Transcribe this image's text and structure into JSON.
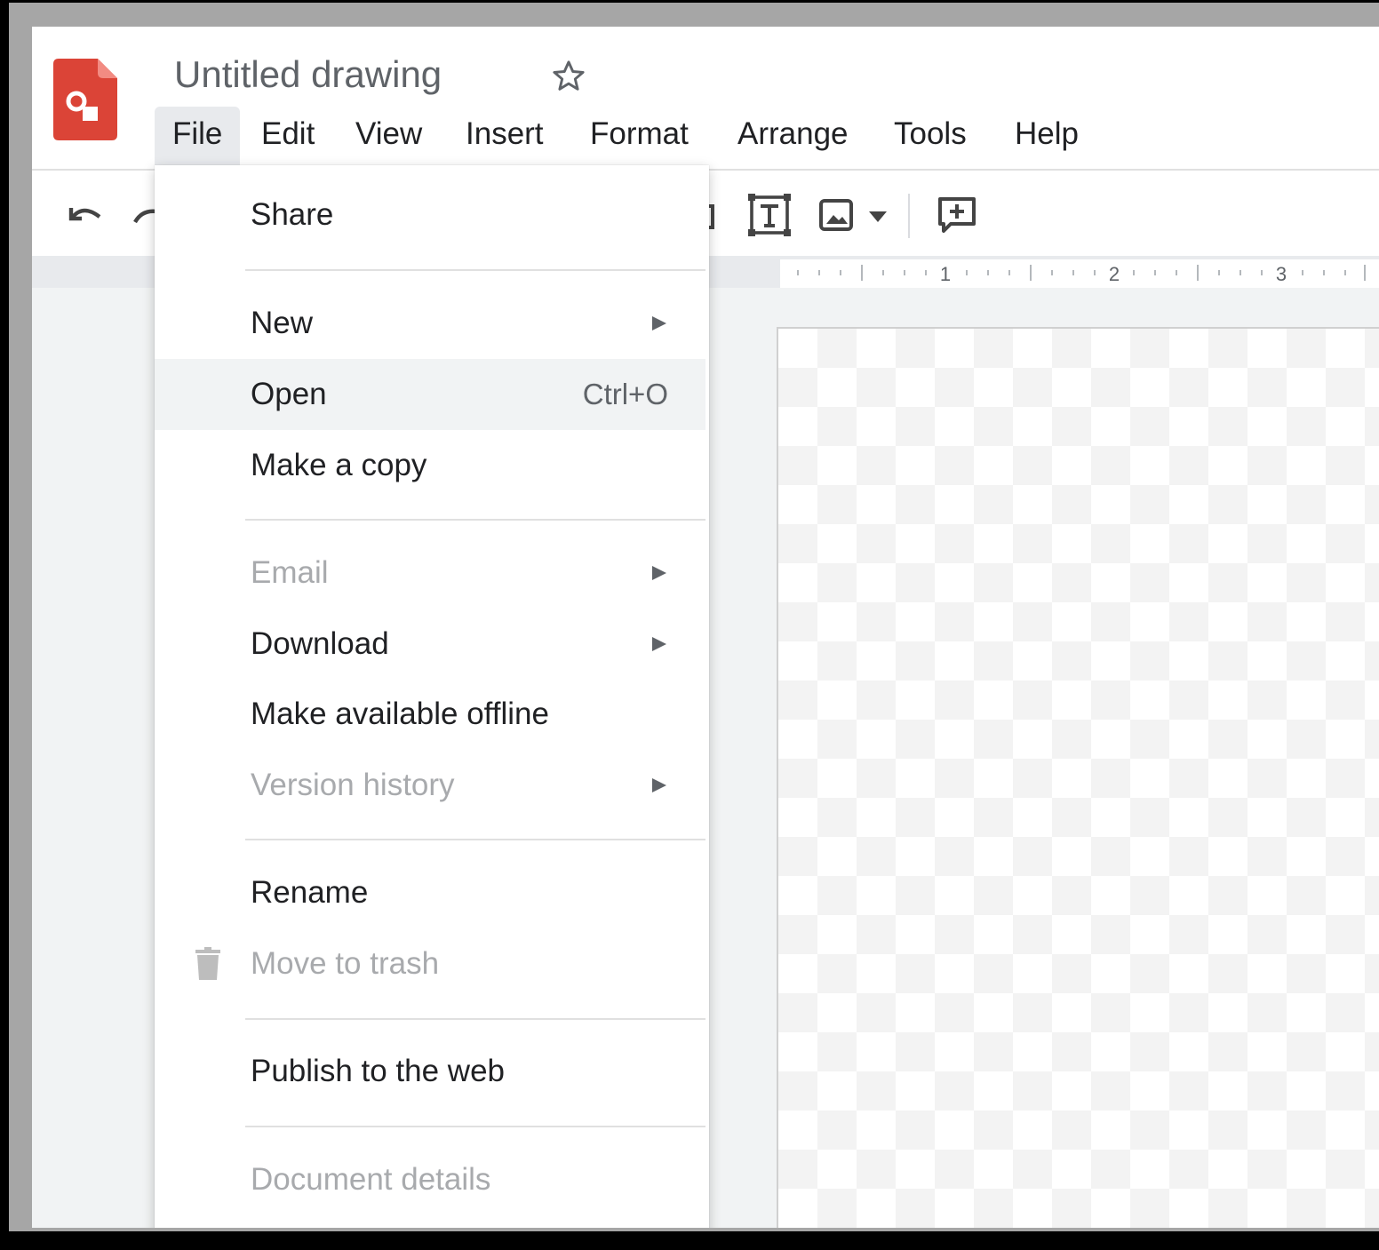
{
  "app": {
    "title": "Untitled drawing",
    "brand_color": "#db4437"
  },
  "menubar": {
    "items": [
      {
        "label": "File",
        "active": true
      },
      {
        "label": "Edit"
      },
      {
        "label": "View"
      },
      {
        "label": "Insert"
      },
      {
        "label": "Format"
      },
      {
        "label": "Arrange"
      },
      {
        "label": "Tools"
      },
      {
        "label": "Help"
      }
    ]
  },
  "toolbar": {
    "icons": [
      "undo-icon",
      "redo-icon",
      "text-box-icon",
      "image-icon",
      "dropdown-caret-icon",
      "add-comment-icon"
    ]
  },
  "ruler": {
    "labels": [
      "1",
      "2",
      "3"
    ]
  },
  "file_menu": {
    "share": "Share",
    "new": "New",
    "open": "Open",
    "open_shortcut": "Ctrl+O",
    "make_copy": "Make a copy",
    "email": "Email",
    "download": "Download",
    "make_offline": "Make available offline",
    "version_history": "Version history",
    "rename": "Rename",
    "move_to_trash": "Move to trash",
    "publish": "Publish to the web",
    "document_details": "Document details"
  }
}
